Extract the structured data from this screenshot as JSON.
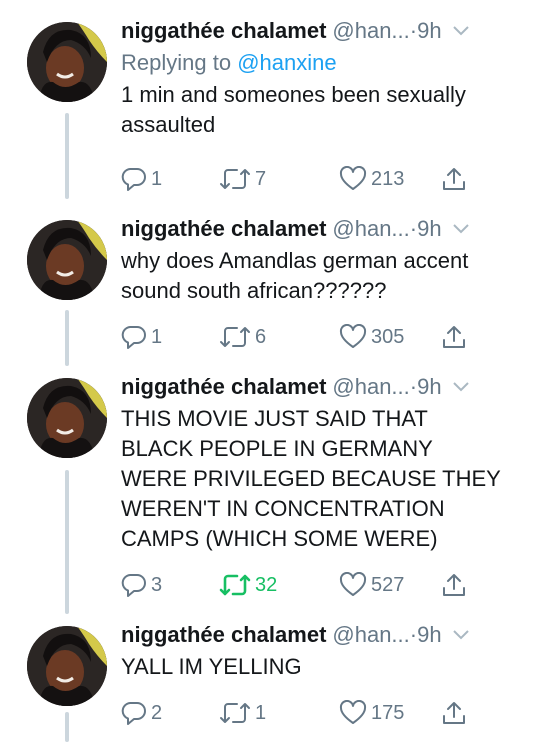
{
  "author": {
    "name": "niggathée chalamet",
    "handle": "@han...",
    "time_sep": " · ",
    "time": "9h"
  },
  "icons": {
    "reply": "reply-icon",
    "retweet": "retweet-icon",
    "like": "heart-icon",
    "share": "share-icon",
    "more": "chevron-down-icon",
    "avatar": "profile-photo"
  },
  "colors": {
    "text": "#14171a",
    "muted": "#657786",
    "link": "#1da1f2",
    "retweet_active": "#17bf63",
    "thread_line": "#ccd6dd"
  },
  "tweets": [
    {
      "replying_prefix": "Replying to ",
      "replying_to": "@hanxine",
      "text": "1 min and someones been sexually\nassaulted",
      "replies": "1",
      "retweets": "7",
      "likes": "213",
      "retweeted": false
    },
    {
      "text": "why does Amandlas german accent\nsound south african??????",
      "replies": "1",
      "retweets": "6",
      "likes": "305",
      "retweeted": false
    },
    {
      "text": "THIS MOVIE JUST SAID THAT\nBLACK PEOPLE IN GERMANY\nWERE PRIVILEGED BECAUSE THEY\nWEREN'T IN CONCENTRATION\nCAMPS (WHICH SOME WERE)",
      "replies": "3",
      "retweets": "32",
      "likes": "527",
      "retweeted": true
    },
    {
      "text": "YALL IM YELLING",
      "replies": "2",
      "retweets": "1",
      "likes": "175",
      "retweeted": false
    }
  ]
}
